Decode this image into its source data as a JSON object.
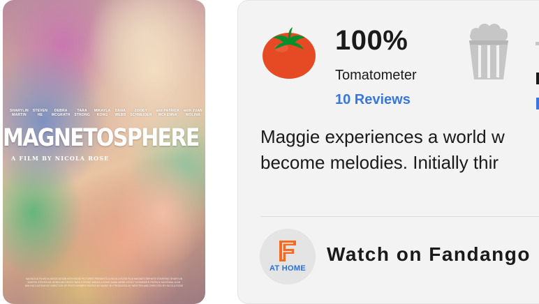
{
  "poster": {
    "title": "MAGNETOSPHERE",
    "director_line": "A FILM BY NICOLA ROSE",
    "credits": [
      [
        "SHARYLIN",
        "MARTIN"
      ],
      [
        "STEVEN",
        "HE"
      ],
      [
        "DEBRA",
        "MCGRATH"
      ],
      [
        "TARA",
        "STRONG"
      ],
      [
        "MIKAYLA",
        "KONG"
      ],
      [
        "DANA",
        "WEBB"
      ],
      [
        "ZOOEY",
        "SCHNEIDER"
      ],
      [
        "and PATRICK",
        "MCKENNA"
      ],
      [
        "with JUAN",
        "MOLINA"
      ]
    ],
    "billing": "MAGNOLIA FILMS IN ASSOCIATION WITH ROSE PICTURES PRESENTS A NICOLA ROSE FILM MAGNETOSPHERE STARRING SHARYLIN MARTIN STEVEN HE DEBRA MCGRATH TARA STRONG MIKAYLA KONG DANA WEBB ZOOEY SCHNEIDER PATRICK MCKENNA JUAN MOLINA CASTING BY DIRECTOR OF PHOTOGRAPHY EDITED BY MUSIC BY PRODUCED BY WRITTEN AND DIRECTED BY NICOLA ROSE"
  },
  "scores": {
    "tomatometer": {
      "value": "100%",
      "label": "Tomatometer",
      "reviews_link": "10 Reviews",
      "icon": "fresh-tomato-icon",
      "color": "#e64a24"
    },
    "audience": {
      "icon": "popcorn-bucket-icon",
      "color": "#c6c6c6"
    }
  },
  "synopsis": {
    "line1": "Maggie experiences a world w",
    "line2": "become melodies. Initially thir"
  },
  "watch": {
    "logo_text": "AT HOME",
    "label": "Watch on Fandango",
    "icon": "fandango-at-home-icon",
    "logo_color": "#f26a24",
    "text_color": "#2b6fd6"
  },
  "colors": {
    "link": "#3976dc",
    "card_bg": "#f3f3f3"
  }
}
